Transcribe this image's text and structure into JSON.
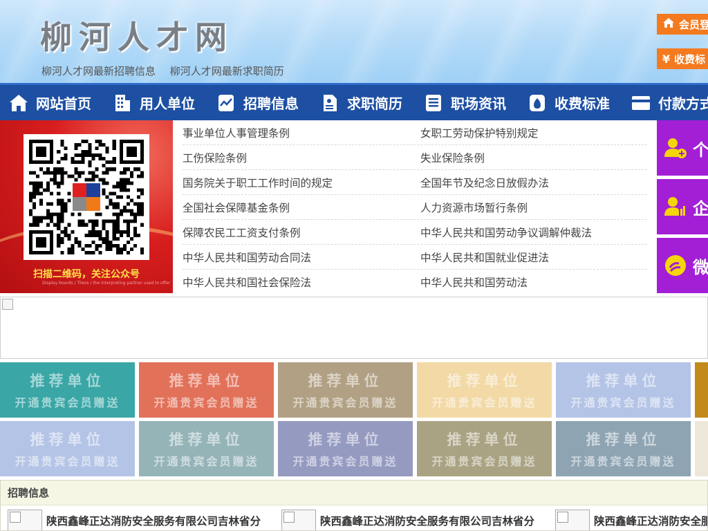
{
  "header": {
    "site_title": "柳河人才网",
    "links": [
      "柳河人才网最新招聘信息",
      "柳河人才网最新求职简历"
    ],
    "login_button": "会员登",
    "fee_button": "收费标"
  },
  "nav": {
    "items": [
      {
        "label": "网站首页",
        "icon": "home-icon"
      },
      {
        "label": "用人单位",
        "icon": "building-icon"
      },
      {
        "label": "招聘信息",
        "icon": "chart-icon"
      },
      {
        "label": "求职简历",
        "icon": "resume-icon"
      },
      {
        "label": "职场资讯",
        "icon": "news-icon"
      },
      {
        "label": "收费标准",
        "icon": "money-bag-icon"
      },
      {
        "label": "付款方式",
        "icon": "card-icon"
      }
    ]
  },
  "qr": {
    "caption": "扫描二维码，关注公众号",
    "tiny_text": "Display boards / There / the interpreting partner used to offer"
  },
  "laws": [
    [
      "事业单位人事管理条例",
      "女职工劳动保护特别规定"
    ],
    [
      "工伤保险条例",
      "失业保险条例"
    ],
    [
      "国务院关于职工工作时间的规定",
      "全国年节及纪念日放假办法"
    ],
    [
      "全国社会保障基金条例",
      "人力资源市场暂行条例"
    ],
    [
      "保障农民工工资支付条例",
      "中华人民共和国劳动争议调解仲裁法"
    ],
    [
      "中华人民共和国劳动合同法",
      "中华人民共和国就业促进法"
    ],
    [
      "中华人民共和国社会保险法",
      "中华人民共和国劳动法"
    ]
  ],
  "side_buttons": [
    {
      "label": "个",
      "icon": "person-add-icon"
    },
    {
      "label": "企",
      "icon": "company-user-icon"
    },
    {
      "label": "微",
      "icon": "wechat-icon"
    }
  ],
  "tiles": {
    "line1": "推荐单位",
    "line2": "开通贵宾会员赠送",
    "colors_row1": [
      "#3aa6a6",
      "#e2715a",
      "#b1a083",
      "#f2d9a6",
      "#b4c4e6",
      "#c28a1a"
    ],
    "colors_row2": [
      "#b4c4e6",
      "#95b4b8",
      "#959ac0",
      "#a9a383",
      "#8ea4b3",
      "#ece7d8"
    ]
  },
  "recruit": {
    "title": "招聘信息",
    "jobs": [
      "陕西鑫峰正达消防安全服务有限公司吉林省分",
      "陕西鑫峰正达消防安全服务有限公司吉林省分",
      "陕西鑫峰正达消防安全服"
    ]
  },
  "colors": {
    "nav_bg": "#1d4fa3",
    "orange": "#f47a1f",
    "purple": "#a21fd6",
    "qr_red": "#d81e1e"
  }
}
